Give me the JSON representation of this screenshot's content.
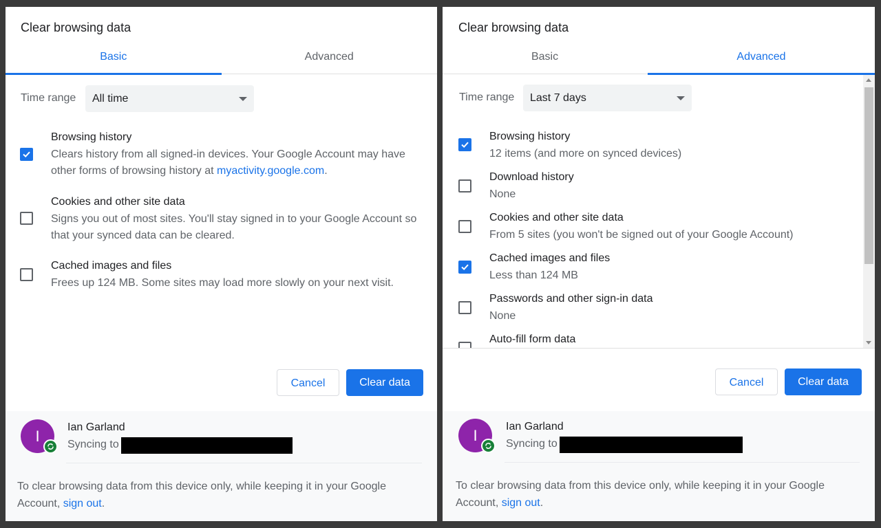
{
  "left": {
    "title": "Clear browsing data",
    "tabs": [
      {
        "label": "Basic",
        "active": true
      },
      {
        "label": "Advanced",
        "active": false
      }
    ],
    "time_range_label": "Time range",
    "time_range_value": "All time",
    "items": [
      {
        "title": "Browsing history",
        "checked": true,
        "desc_pre": "Clears history from all signed-in devices. Your Google Account may have other forms of browsing history at ",
        "desc_link": "myactivity.google.com",
        "desc_post": "."
      },
      {
        "title": "Cookies and other site data",
        "checked": false,
        "desc": "Signs you out of most sites. You'll stay signed in to your Google Account so that your synced data can be cleared."
      },
      {
        "title": "Cached images and files",
        "checked": false,
        "desc": "Frees up 124 MB. Some sites may load more slowly on your next visit."
      }
    ],
    "cancel_label": "Cancel",
    "clear_label": "Clear data",
    "account": {
      "initial": "I",
      "name": "Ian Garland",
      "syncing": "Syncing to"
    },
    "footer_pre": "To clear browsing data from this device only, while keeping it in your Google Account, ",
    "footer_link": "sign out",
    "footer_post": "."
  },
  "right": {
    "title": "Clear browsing data",
    "tabs": [
      {
        "label": "Basic",
        "active": false
      },
      {
        "label": "Advanced",
        "active": true
      }
    ],
    "time_range_label": "Time range",
    "time_range_value": "Last 7 days",
    "items": [
      {
        "title": "Browsing history",
        "checked": true,
        "desc": "12 items (and more on synced devices)"
      },
      {
        "title": "Download history",
        "checked": false,
        "desc": "None"
      },
      {
        "title": "Cookies and other site data",
        "checked": false,
        "desc": "From 5 sites (you won't be signed out of your Google Account)"
      },
      {
        "title": "Cached images and files",
        "checked": true,
        "desc": "Less than 124 MB"
      },
      {
        "title": "Passwords and other sign-in data",
        "checked": false,
        "desc": "None"
      },
      {
        "title": "Auto-fill form data",
        "checked": false,
        "desc": ""
      }
    ],
    "cancel_label": "Cancel",
    "clear_label": "Clear data",
    "account": {
      "initial": "I",
      "name": "Ian Garland",
      "syncing": "Syncing to"
    },
    "footer_pre": "To clear browsing data from this device only, while keeping it in your Google Account, ",
    "footer_link": "sign out",
    "footer_post": "."
  },
  "colors": {
    "accent": "#1a73e8",
    "avatar": "#8e24aa",
    "sync": "#188038"
  }
}
